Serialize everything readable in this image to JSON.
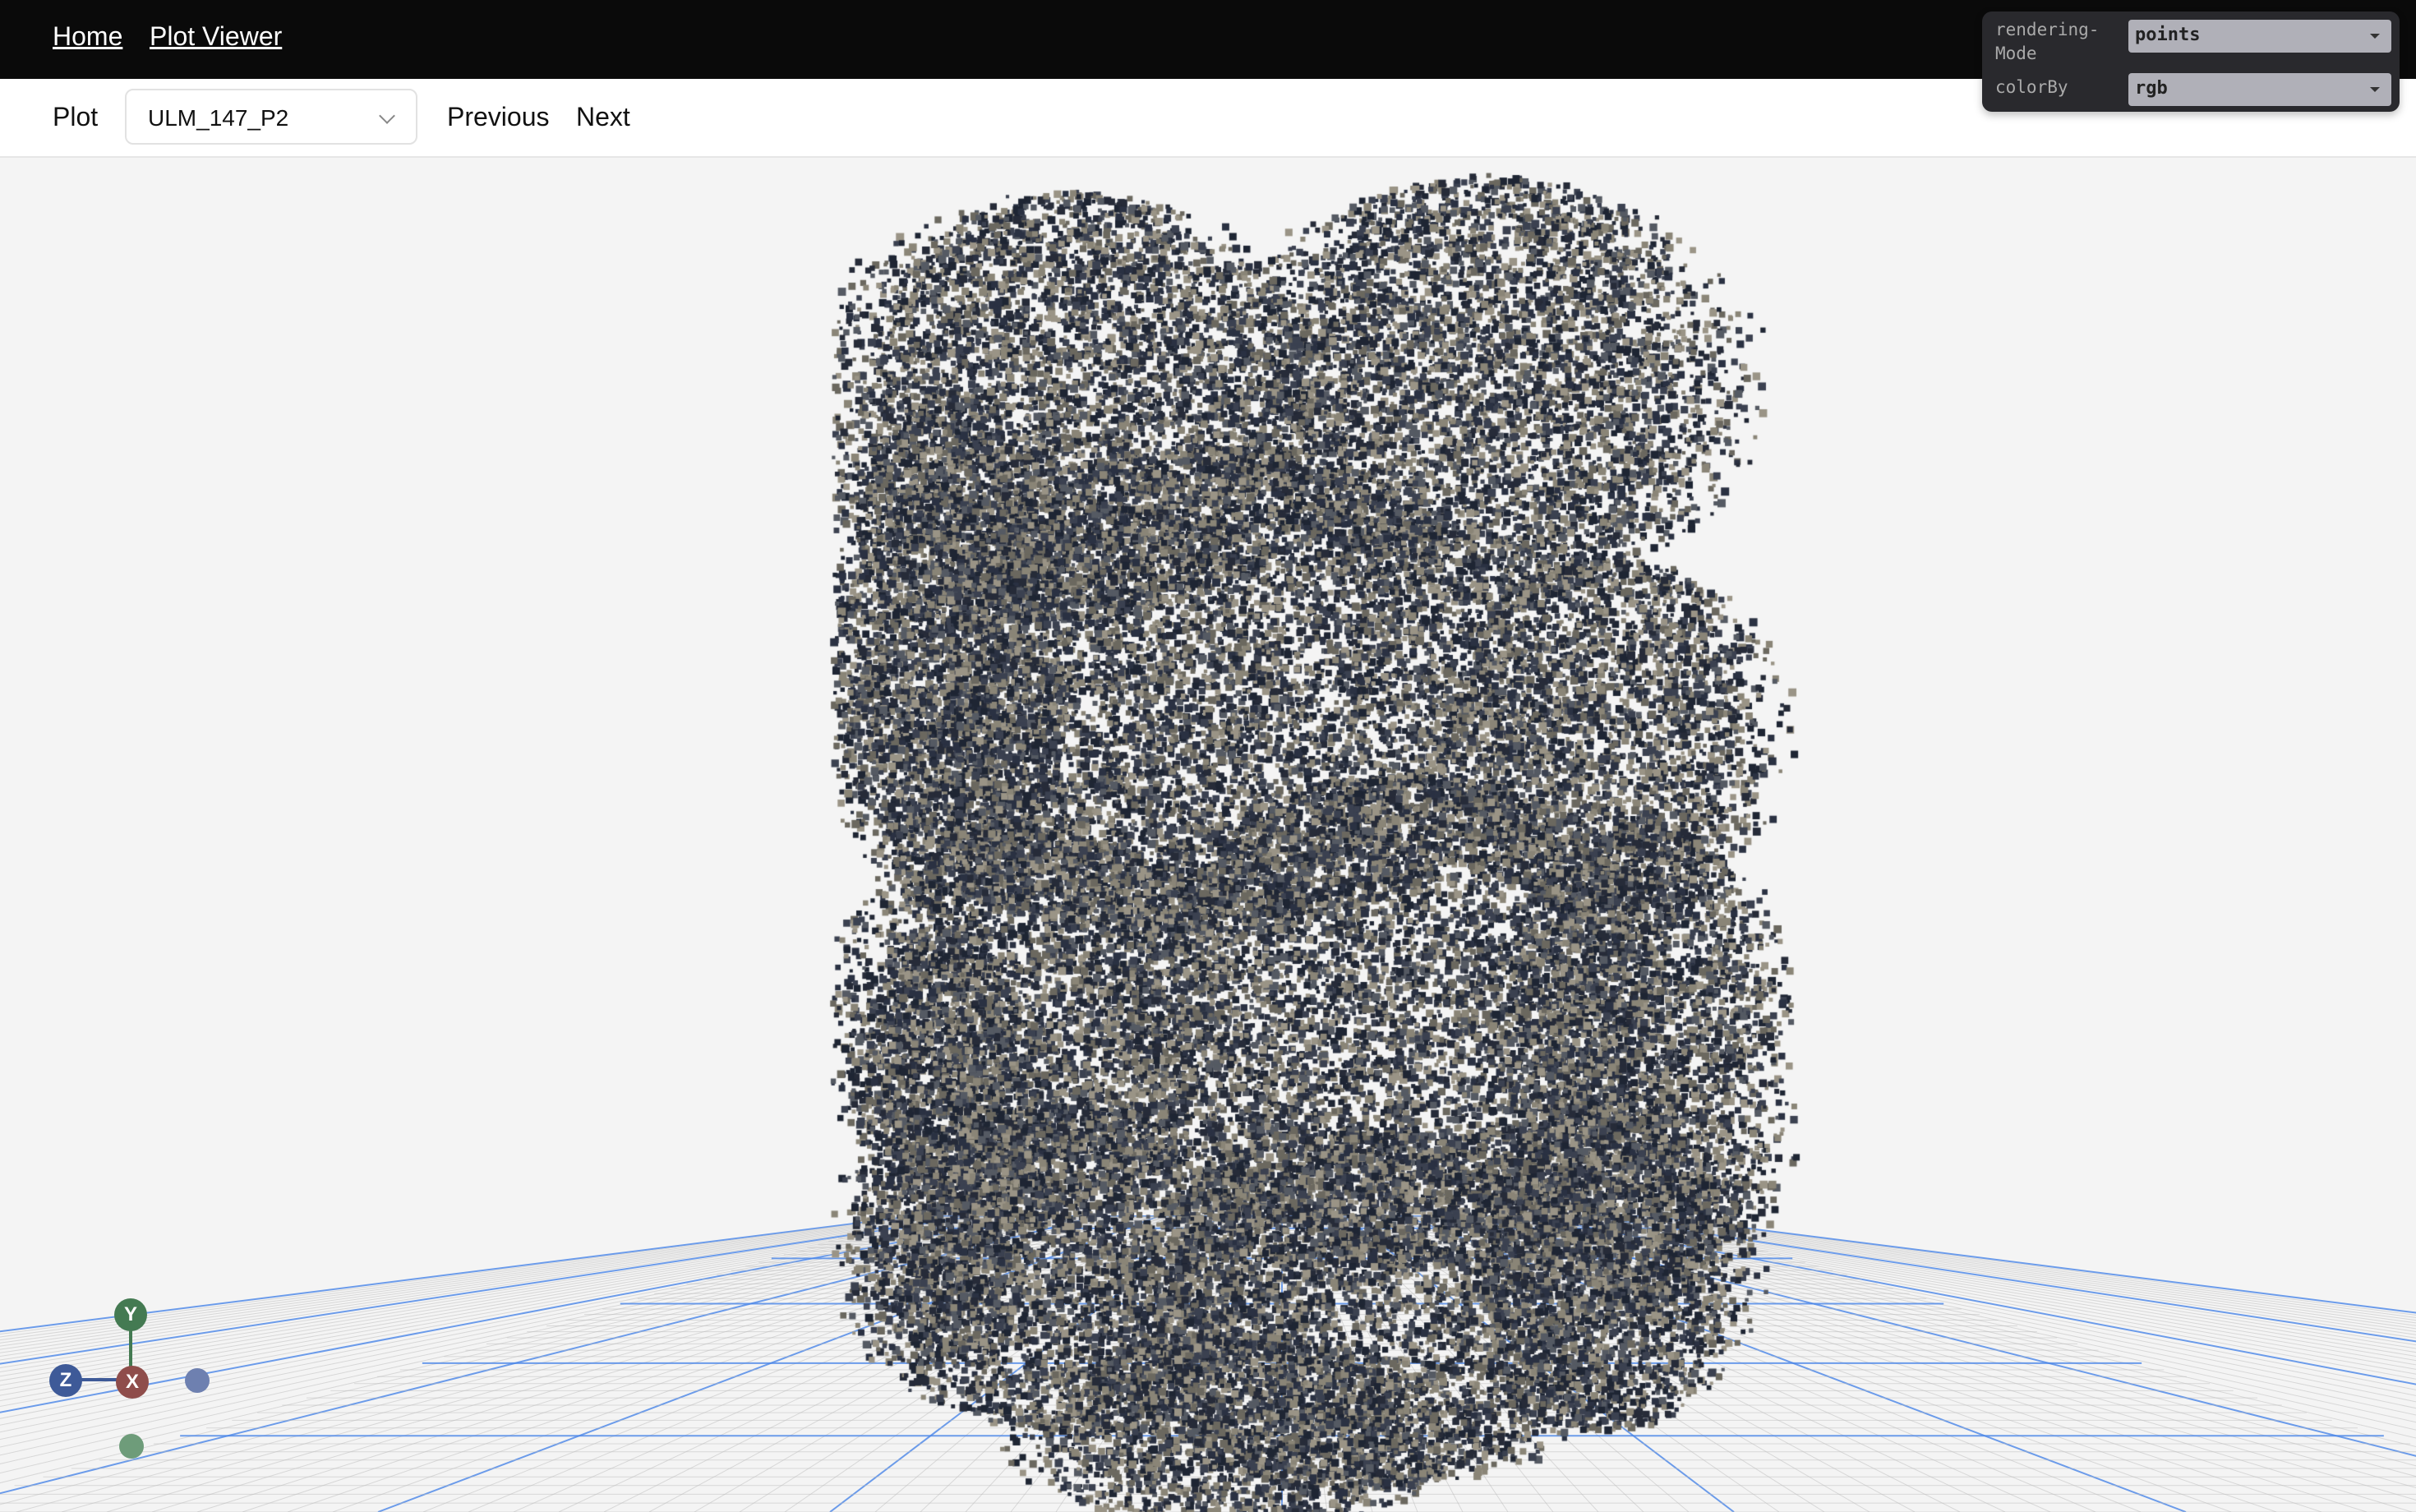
{
  "nav": {
    "home": "Home",
    "plot_viewer": "Plot Viewer"
  },
  "toolbar": {
    "plot_label": "Plot",
    "plot_value": "ULM_147_P2",
    "previous": "Previous",
    "next": "Next"
  },
  "controls": {
    "rendering_mode_label_1": "rendering-",
    "rendering_mode_label_2": "Mode",
    "rendering_mode_value": "points",
    "color_by_label": "colorBy",
    "color_by_value": "rgb"
  },
  "gizmo": {
    "y": "Y",
    "z": "Z",
    "x": "X",
    "colors": {
      "x": "#8f4d4b",
      "y": "#447a52",
      "z": "#3e5a98"
    }
  },
  "colors": {
    "grid": "#4a86e8",
    "points_dark": "#1e2533",
    "points_light": "#8a8577"
  }
}
